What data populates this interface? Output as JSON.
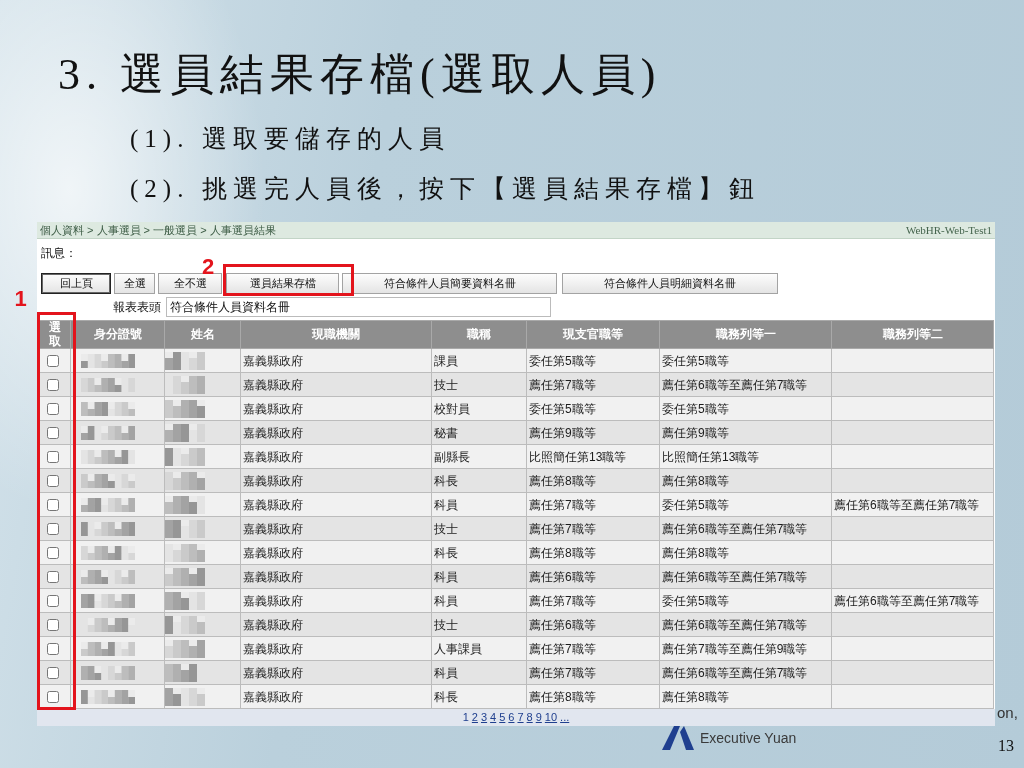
{
  "slide": {
    "title": "3. 選員結果存檔(選取人員)",
    "bullets": [
      "(1). 選取要儲存的人員",
      "(2). 挑選完人員後，按下【選員結果存檔】鈕"
    ],
    "footer": {
      "organization": "Executive Yuan",
      "partial_text": "on,",
      "page_number": "13"
    }
  },
  "app": {
    "breadcrumb": "個人資料 > 人事選員 > 一般選員 > 人事選員結果",
    "host": "WebHR-Web-Test1",
    "message_label": "訊息：",
    "buttons": [
      {
        "label": "回上頁",
        "focused": true
      },
      {
        "label": "全選",
        "focused": false
      },
      {
        "label": "全不選",
        "focused": false
      },
      {
        "label": "選員結果存檔",
        "focused": false,
        "callout": "2"
      },
      {
        "label": "符合條件人員簡要資料名冊",
        "focused": false
      },
      {
        "label": "符合條件人員明細資料名冊",
        "focused": false
      }
    ],
    "report_header": {
      "label": "報表表頭",
      "value": "符合條件人員資料名冊"
    },
    "table": {
      "columns": [
        {
          "label": "選取",
          "kind": "checkbox",
          "callout": "1"
        },
        {
          "label": "身分證號",
          "kind": "redacted"
        },
        {
          "label": "姓名",
          "kind": "redacted"
        },
        {
          "label": "現職機關",
          "kind": "text"
        },
        {
          "label": "職稱",
          "kind": "text"
        },
        {
          "label": "現支官職等",
          "kind": "text"
        },
        {
          "label": "職務列等一",
          "kind": "text"
        },
        {
          "label": "職務列等二",
          "kind": "text"
        }
      ],
      "rows": [
        {
          "checked": false,
          "cells": [
            "",
            "",
            "",
            "嘉義縣政府",
            "課員",
            "委任第5職等",
            "委任第5職等",
            ""
          ]
        },
        {
          "checked": false,
          "cells": [
            "",
            "",
            "",
            "嘉義縣政府",
            "技士",
            "薦任第7職等",
            "薦任第6職等至薦任第7職等",
            ""
          ]
        },
        {
          "checked": false,
          "cells": [
            "",
            "",
            "",
            "嘉義縣政府",
            "校對員",
            "委任第5職等",
            "委任第5職等",
            ""
          ]
        },
        {
          "checked": false,
          "cells": [
            "",
            "",
            "",
            "嘉義縣政府",
            "秘書",
            "薦任第9職等",
            "薦任第9職等",
            ""
          ]
        },
        {
          "checked": false,
          "cells": [
            "",
            "",
            "",
            "嘉義縣政府",
            "副縣長",
            "比照簡任第13職等",
            "比照簡任第13職等",
            ""
          ]
        },
        {
          "checked": false,
          "cells": [
            "",
            "",
            "",
            "嘉義縣政府",
            "科長",
            "薦任第8職等",
            "薦任第8職等",
            ""
          ]
        },
        {
          "checked": false,
          "cells": [
            "",
            "",
            "",
            "嘉義縣政府",
            "科員",
            "薦任第7職等",
            "委任第5職等",
            "薦任第6職等至薦任第7職等"
          ]
        },
        {
          "checked": false,
          "cells": [
            "",
            "",
            "",
            "嘉義縣政府",
            "技士",
            "薦任第7職等",
            "薦任第6職等至薦任第7職等",
            ""
          ]
        },
        {
          "checked": false,
          "cells": [
            "",
            "",
            "",
            "嘉義縣政府",
            "科長",
            "薦任第8職等",
            "薦任第8職等",
            ""
          ]
        },
        {
          "checked": false,
          "cells": [
            "",
            "",
            "",
            "嘉義縣政府",
            "科員",
            "薦任第6職等",
            "薦任第6職等至薦任第7職等",
            ""
          ]
        },
        {
          "checked": false,
          "cells": [
            "",
            "",
            "",
            "嘉義縣政府",
            "科員",
            "薦任第7職等",
            "委任第5職等",
            "薦任第6職等至薦任第7職等"
          ]
        },
        {
          "checked": false,
          "cells": [
            "",
            "",
            "",
            "嘉義縣政府",
            "技士",
            "薦任第6職等",
            "薦任第6職等至薦任第7職等",
            ""
          ]
        },
        {
          "checked": false,
          "cells": [
            "",
            "",
            "",
            "嘉義縣政府",
            "人事課員",
            "薦任第7職等",
            "薦任第7職等至薦任第9職等",
            ""
          ]
        },
        {
          "checked": false,
          "cells": [
            "",
            "",
            "",
            "嘉義縣政府",
            "科員",
            "薦任第7職等",
            "薦任第6職等至薦任第7職等",
            ""
          ]
        },
        {
          "checked": false,
          "cells": [
            "",
            "",
            "",
            "嘉義縣政府",
            "科長",
            "薦任第8職等",
            "薦任第8職等",
            ""
          ]
        }
      ]
    },
    "pager": [
      {
        "label": "1",
        "selected": true
      },
      {
        "label": "2",
        "selected": false
      },
      {
        "label": "3",
        "selected": false
      },
      {
        "label": "4",
        "selected": false
      },
      {
        "label": "5",
        "selected": false
      },
      {
        "label": "6",
        "selected": false
      },
      {
        "label": "7",
        "selected": false
      },
      {
        "label": "8",
        "selected": false
      },
      {
        "label": "9",
        "selected": false
      },
      {
        "label": "10",
        "selected": false
      },
      {
        "label": "...",
        "selected": false
      }
    ]
  }
}
